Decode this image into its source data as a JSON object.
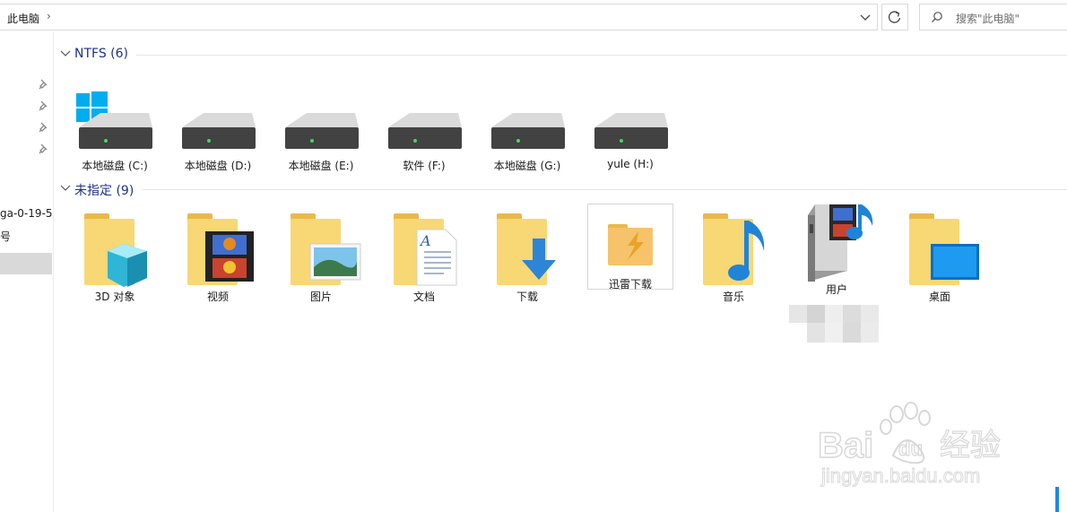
{
  "address_bar": {
    "location": "此电脑",
    "separator": "›"
  },
  "search": {
    "placeholder": "搜索\"此电脑\""
  },
  "nav_pane": {
    "partial_item": "ga-0-19-5",
    "partial_item2": "号"
  },
  "groups": {
    "ntfs": {
      "title": "NTFS (6)"
    },
    "unassigned": {
      "title": "未指定 (9)"
    }
  },
  "drives": [
    {
      "label": "本地磁盘 (C:)",
      "icon": "windows-drive-icon"
    },
    {
      "label": "本地磁盘 (D:)",
      "icon": "hard-drive-icon"
    },
    {
      "label": "本地磁盘 (E:)",
      "icon": "hard-drive-icon"
    },
    {
      "label": "软件 (F:)",
      "icon": "hard-drive-icon"
    },
    {
      "label": "本地磁盘 (G:)",
      "icon": "hard-drive-icon"
    },
    {
      "label": "yule (H:)",
      "icon": "hard-drive-icon"
    }
  ],
  "folders": [
    {
      "label": "3D 对象",
      "icon": "3d-objects-folder-icon"
    },
    {
      "label": "视频",
      "icon": "videos-folder-icon"
    },
    {
      "label": "图片",
      "icon": "pictures-folder-icon"
    },
    {
      "label": "文档",
      "icon": "documents-folder-icon"
    },
    {
      "label": "下载",
      "icon": "downloads-folder-icon"
    },
    {
      "label": "迅雷下载",
      "icon": "thunder-folder-icon"
    },
    {
      "label": "音乐",
      "icon": "music-folder-icon"
    },
    {
      "label": "用户",
      "icon": "media-server-icon"
    },
    {
      "label": "桌面",
      "icon": "desktop-folder-icon"
    }
  ],
  "watermark": {
    "brand": "Bai",
    "brand2": "du",
    "brand_cn": "经验",
    "url": "jingyan.baidu.com"
  },
  "colors": {
    "accent": "#1e88e5",
    "folder": "#f8d775",
    "group_title": "#1e3287"
  }
}
